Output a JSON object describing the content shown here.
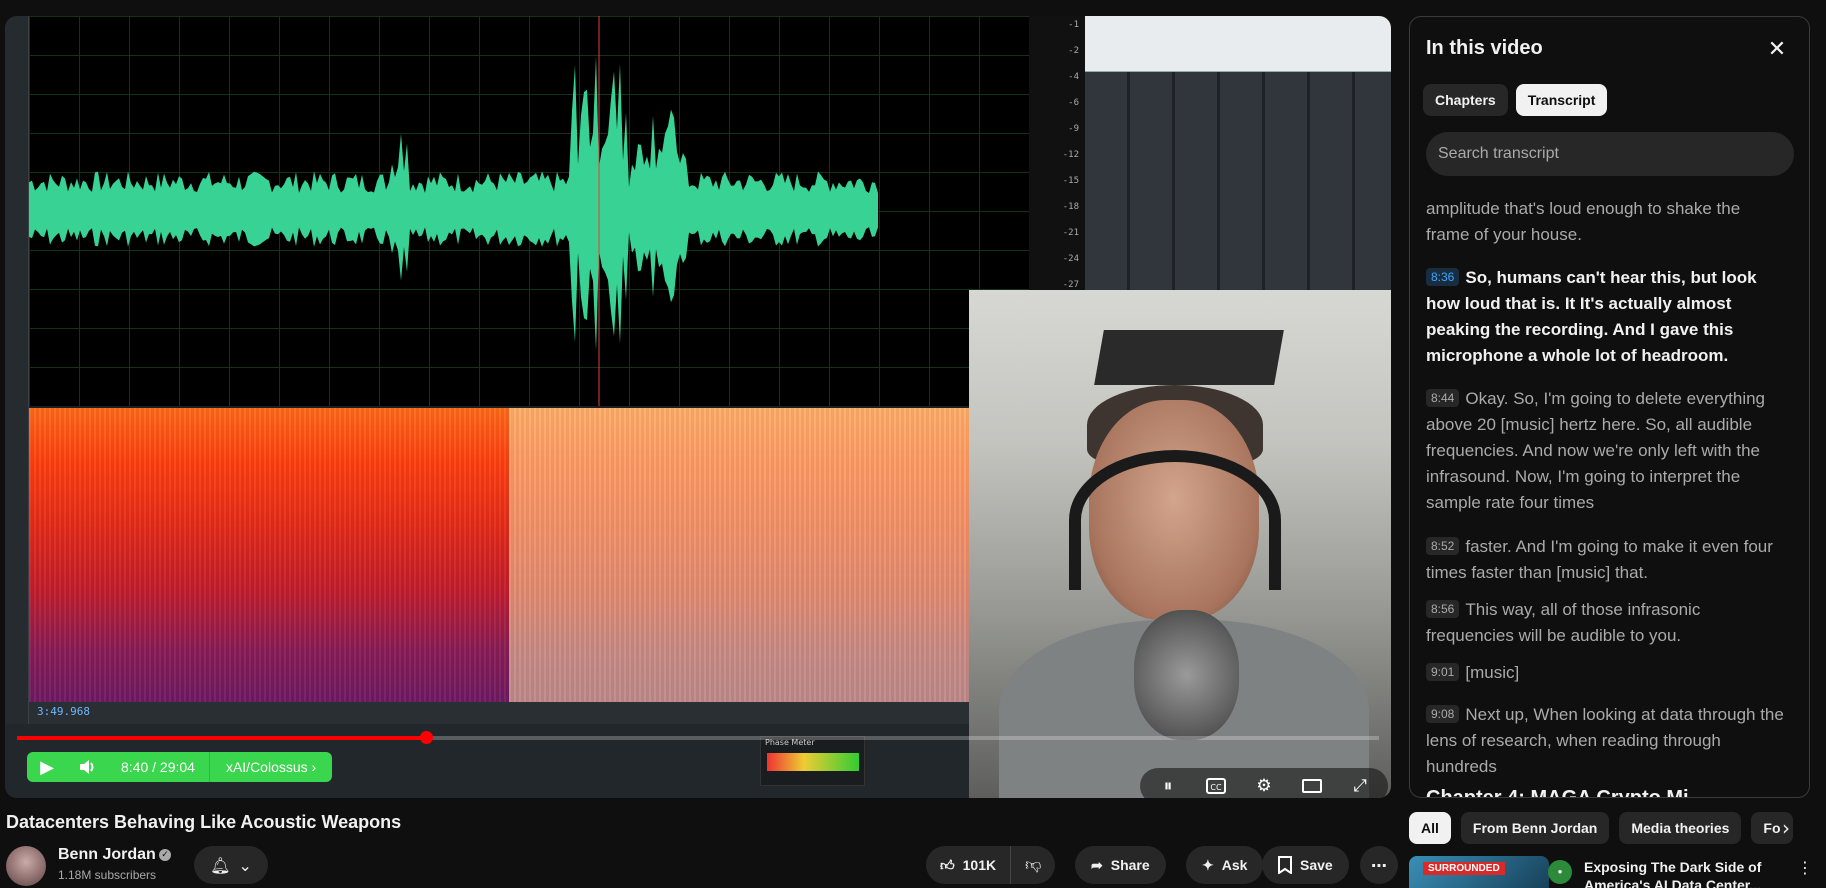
{
  "daw": {
    "timecode": "3:49.968",
    "phase_meter_label": "Phase Meter",
    "ruler_ticks": [
      "-1",
      "-2",
      "-4",
      "-6",
      "-9",
      "-12",
      "-15",
      "-18",
      "-21",
      "-24",
      "-27"
    ]
  },
  "player": {
    "progress_fraction": 0.3,
    "time": "8:40 / 29:04",
    "chapter": "xAI/Colossus",
    "icons": {
      "play": "play-icon",
      "volume": "volume-icon",
      "pause": "pause-icon",
      "captions": "captions-icon",
      "settings": "gear-icon",
      "theater": "theater-icon",
      "fullscreen": "fullscreen-icon"
    }
  },
  "video": {
    "title": "Datacenters Behaving Like Acoustic Weapons",
    "channel": "Benn Jordan",
    "subscribers": "1.18M subscribers",
    "likes": "101K",
    "share_label": "Share",
    "ask_label": "Ask",
    "save_label": "Save"
  },
  "panel": {
    "title": "In this video",
    "tabs": [
      "Chapters",
      "Transcript"
    ],
    "active_tab": "Transcript",
    "search_placeholder": "Search transcript",
    "segments": [
      {
        "time": "",
        "text": "amplitude that's loud enough to shake the frame of your house."
      },
      {
        "time": "8:36",
        "text": "So, humans can't hear this, but look how loud that is. It It's actually almost peaking the recording. And I gave this microphone a whole lot of headroom.",
        "active": true
      },
      {
        "time": "8:44",
        "text": "Okay. So, I'm going to delete everything above 20 [music] hertz here. So, all audible frequencies. And now we're only left with the infrasound. Now, I'm going to interpret the sample rate four times"
      },
      {
        "time": "8:52",
        "text": "faster. And I'm going to make it even four times faster than [music] that."
      },
      {
        "time": "8:56",
        "text": "This way, all of those infrasonic frequencies will be audible to you."
      },
      {
        "time": "9:01",
        "text": "[music]"
      },
      {
        "time": "9:08",
        "text": "Next up, When looking at data through the lens of research, when reading through hundreds"
      }
    ],
    "next_chapter_peek": "Chapter 4: MAGA Crypto Mi..."
  },
  "chips": [
    "All",
    "From Benn Jordan",
    "Media theories",
    "Fo"
  ],
  "recommendation": {
    "badge": "SURROUNDED",
    "title": "Exposing The Dark Side of America's AI Data Center..."
  }
}
